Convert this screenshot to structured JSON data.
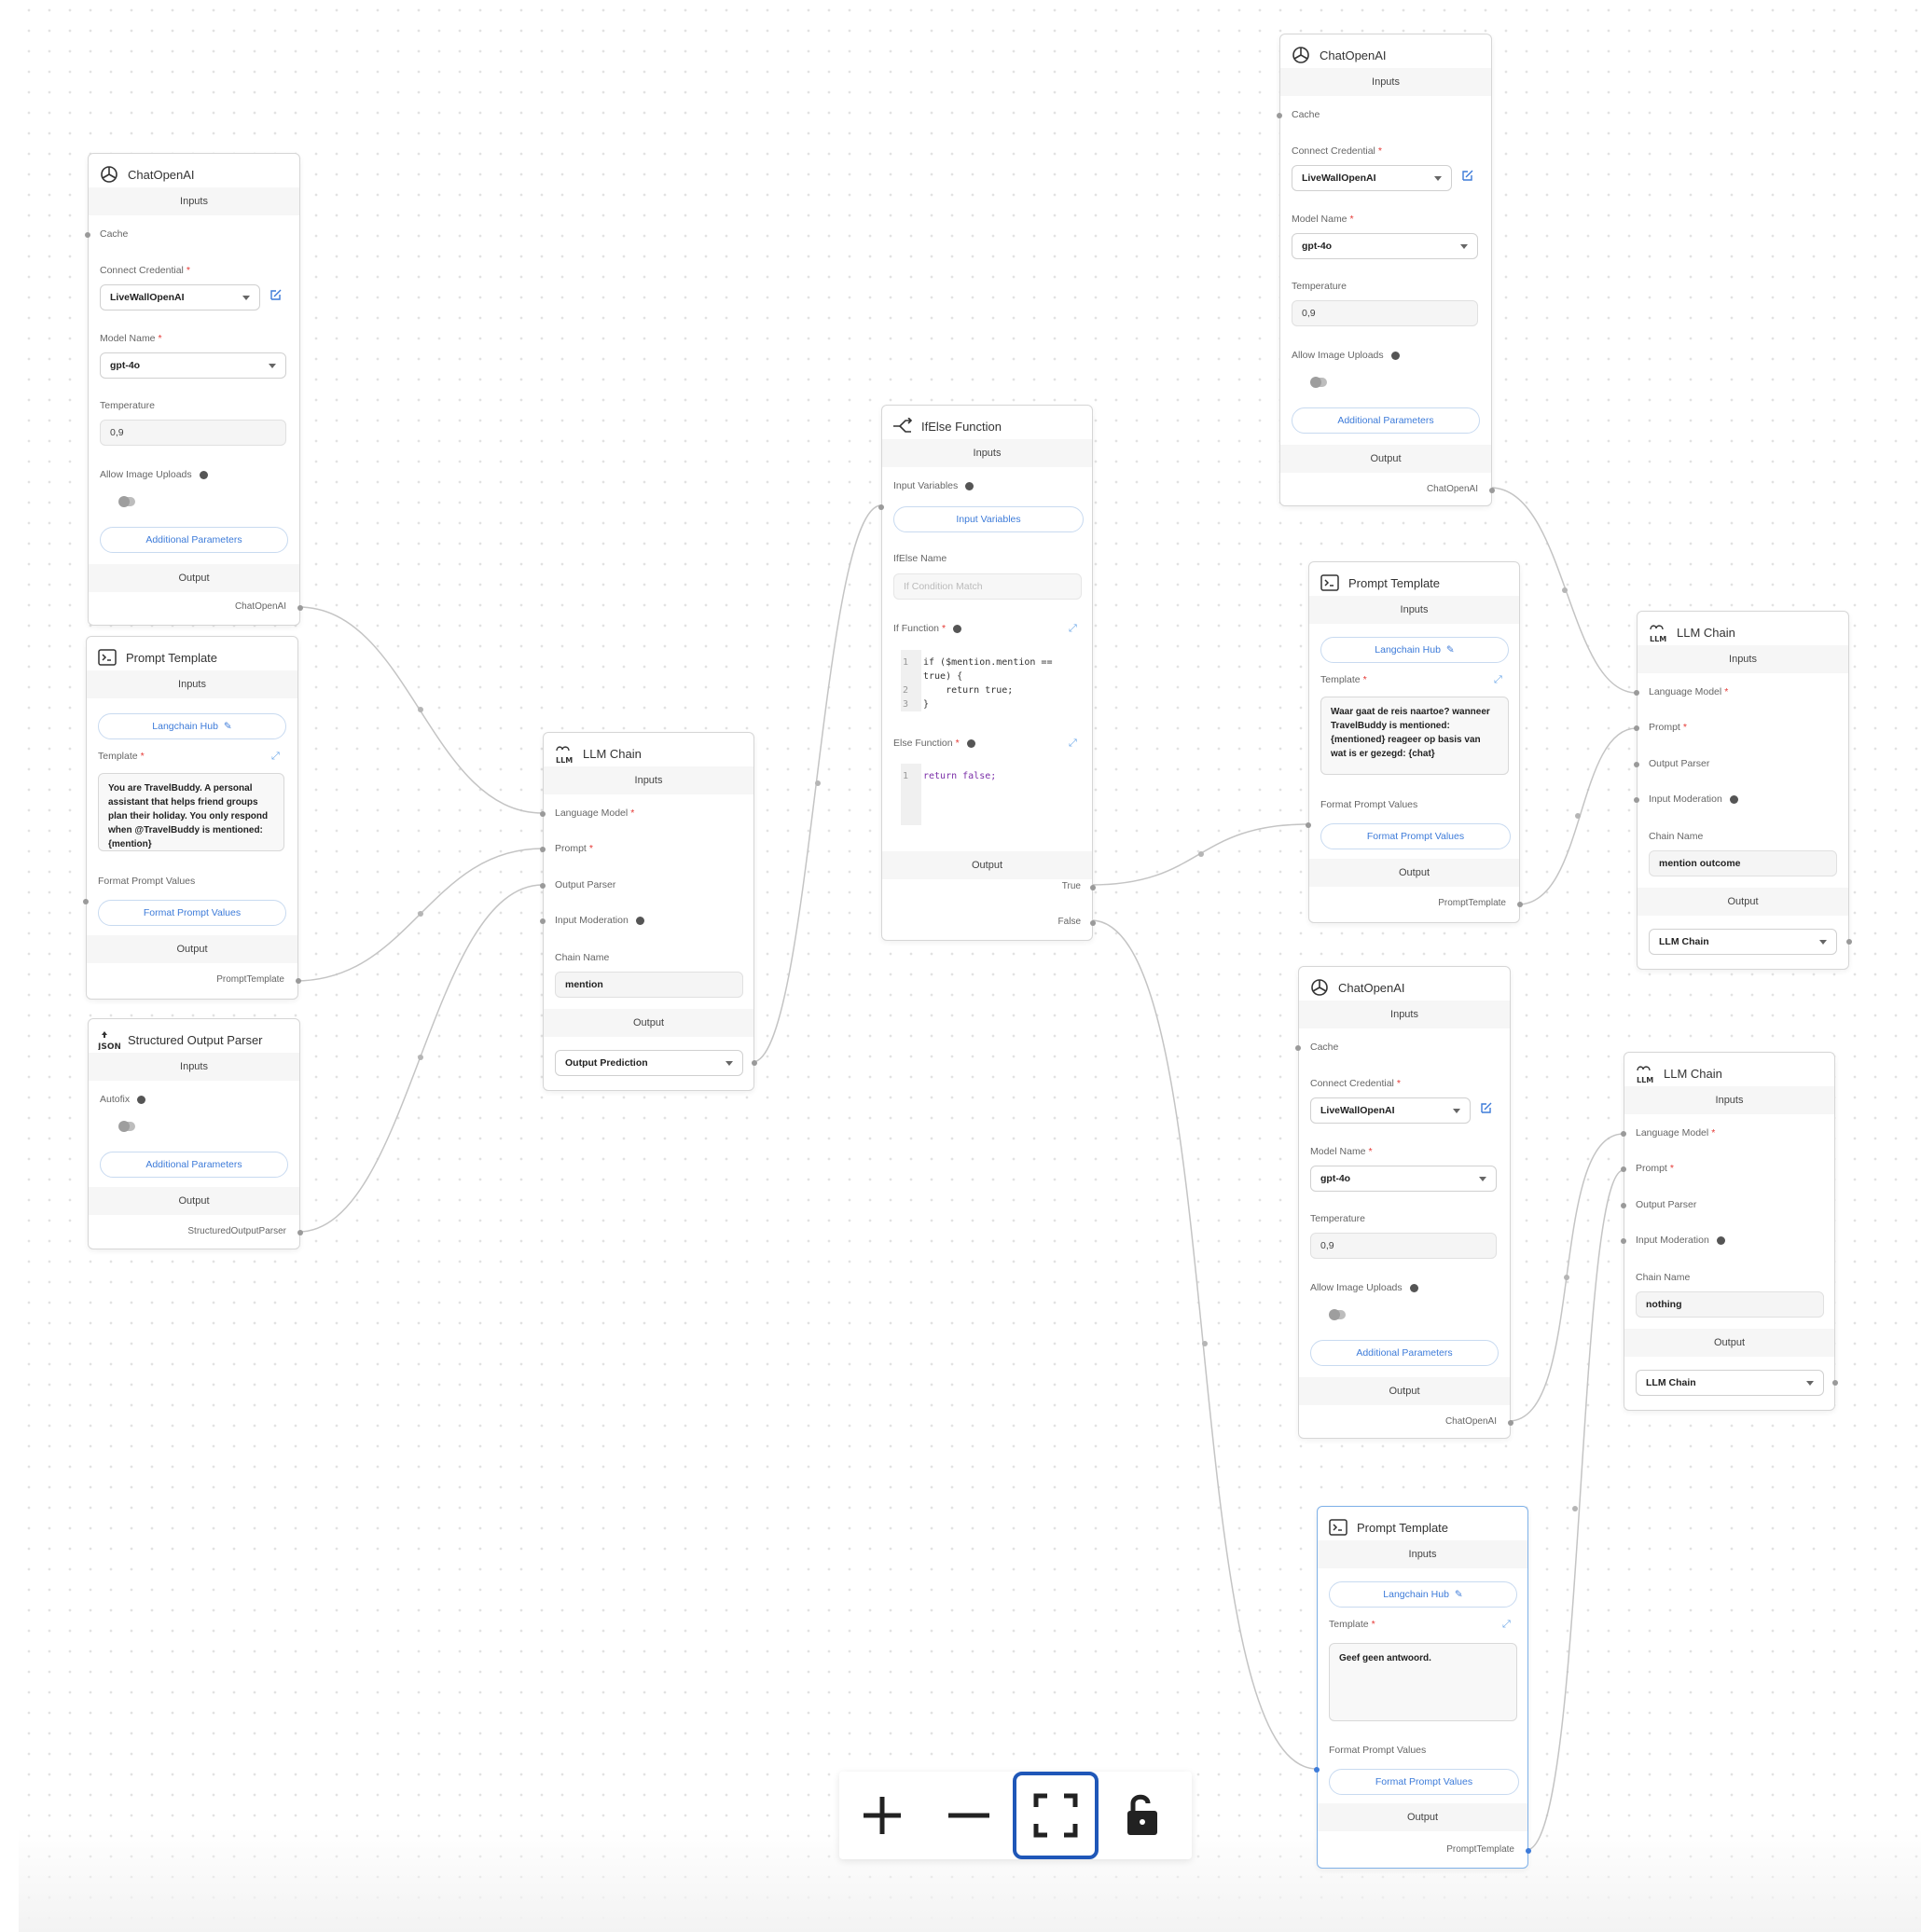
{
  "common": {
    "inputs": "Inputs",
    "output": "Output",
    "cache": "Cache",
    "connect_credential": "Connect Credential",
    "model_name": "Model Name",
    "temperature": "Temperature",
    "allow_image_uploads": "Allow Image Uploads",
    "additional_parameters": "Additional Parameters",
    "template": "Template",
    "format_prompt_values_label": "Format Prompt Values",
    "format_prompt_values_button": "Format Prompt Values",
    "langchain_hub": "Langchain Hub",
    "language_model": "Language Model",
    "prompt": "Prompt",
    "output_parser": "Output Parser",
    "input_moderation": "Input Moderation",
    "chain_name": "Chain Name",
    "required_mark": "*"
  },
  "nodes": {
    "chat1": {
      "title": "ChatOpenAI",
      "credential": "LiveWallOpenAI",
      "model": "gpt-4o",
      "temperature": "0,9",
      "output_label": "ChatOpenAI"
    },
    "prompt1": {
      "title": "Prompt Template",
      "template": "You are TravelBuddy. A personal assistant that helps friend groups plan their holiday. You only respond when @TravelBuddy is mentioned: {mention}",
      "output_label": "PromptTemplate"
    },
    "parser1": {
      "title": "Structured Output Parser",
      "autofix": "Autofix",
      "output_label": "StructuredOutputParser"
    },
    "llm1": {
      "title": "LLM Chain",
      "chain_name": "mention",
      "output_select": "Output Prediction"
    },
    "ifelse": {
      "title": "IfElse Function",
      "input_variables_label": "Input Variables",
      "input_variables_button": "Input Variables",
      "ifelse_name_label": "IfElse Name",
      "ifelse_name_placeholder": "If Condition Match",
      "if_function_label": "If Function",
      "else_function_label": "Else Function",
      "if_code": [
        "if ($mention.mention ==",
        "true) {",
        "    return true;",
        "}"
      ],
      "else_code": [
        "return false;"
      ],
      "true_label": "True",
      "false_label": "False"
    },
    "chat2": {
      "title": "ChatOpenAI",
      "credential": "LiveWallOpenAI",
      "model": "gpt-4o",
      "temperature": "0,9",
      "output_label": "ChatOpenAI"
    },
    "prompt2": {
      "title": "Prompt Template",
      "template": "Waar gaat de reis naartoe? wanneer TravelBuddy is mentioned: {mentioned} reageer op basis van wat is er gezegd: {chat}",
      "output_label": "PromptTemplate"
    },
    "llm2": {
      "title": "LLM Chain",
      "chain_name": "mention outcome",
      "output_select": "LLM Chain"
    },
    "chat3": {
      "title": "ChatOpenAI",
      "credential": "LiveWallOpenAI",
      "model": "gpt-4o",
      "temperature": "0,9",
      "output_label": "ChatOpenAI"
    },
    "llm3": {
      "title": "LLM Chain",
      "chain_name": "nothing",
      "output_select": "LLM Chain"
    },
    "prompt3": {
      "title": "Prompt Template",
      "template": "Geef geen antwoord.",
      "output_label": "PromptTemplate"
    }
  },
  "toolbar": {
    "zoom_in_icon": "plus-icon",
    "zoom_out_icon": "minus-icon",
    "fit_view_icon": "fit-view-icon",
    "lock_icon": "unlock-icon",
    "active": "fit_view"
  },
  "colors": {
    "accent": "#3d7bd9",
    "required": "#e53935",
    "selected_border": "#1f57b8"
  }
}
